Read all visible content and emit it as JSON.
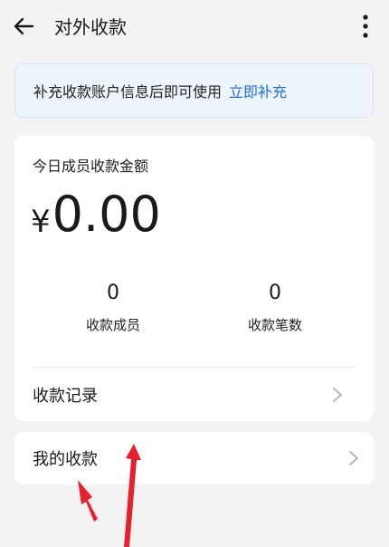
{
  "header": {
    "title": "对外收款",
    "back_icon": "arrow-left-icon",
    "more_icon": "more-vertical-icon"
  },
  "notice": {
    "text": "补充收款账户信息后即可使用",
    "link": "立即补充",
    "link_color": "#1f6fcf"
  },
  "summary": {
    "label": "今日成员收款金额",
    "currency": "¥",
    "amount": "0.00",
    "stats": [
      {
        "value": "0",
        "label": "收款成员"
      },
      {
        "value": "0",
        "label": "收款笔数"
      }
    ],
    "records_label": "收款记录"
  },
  "my_payments": {
    "label": "我的收款"
  },
  "colors": {
    "background": "#f3f3f3",
    "card": "#ffffff",
    "annotation_arrow": "#e8202e"
  }
}
